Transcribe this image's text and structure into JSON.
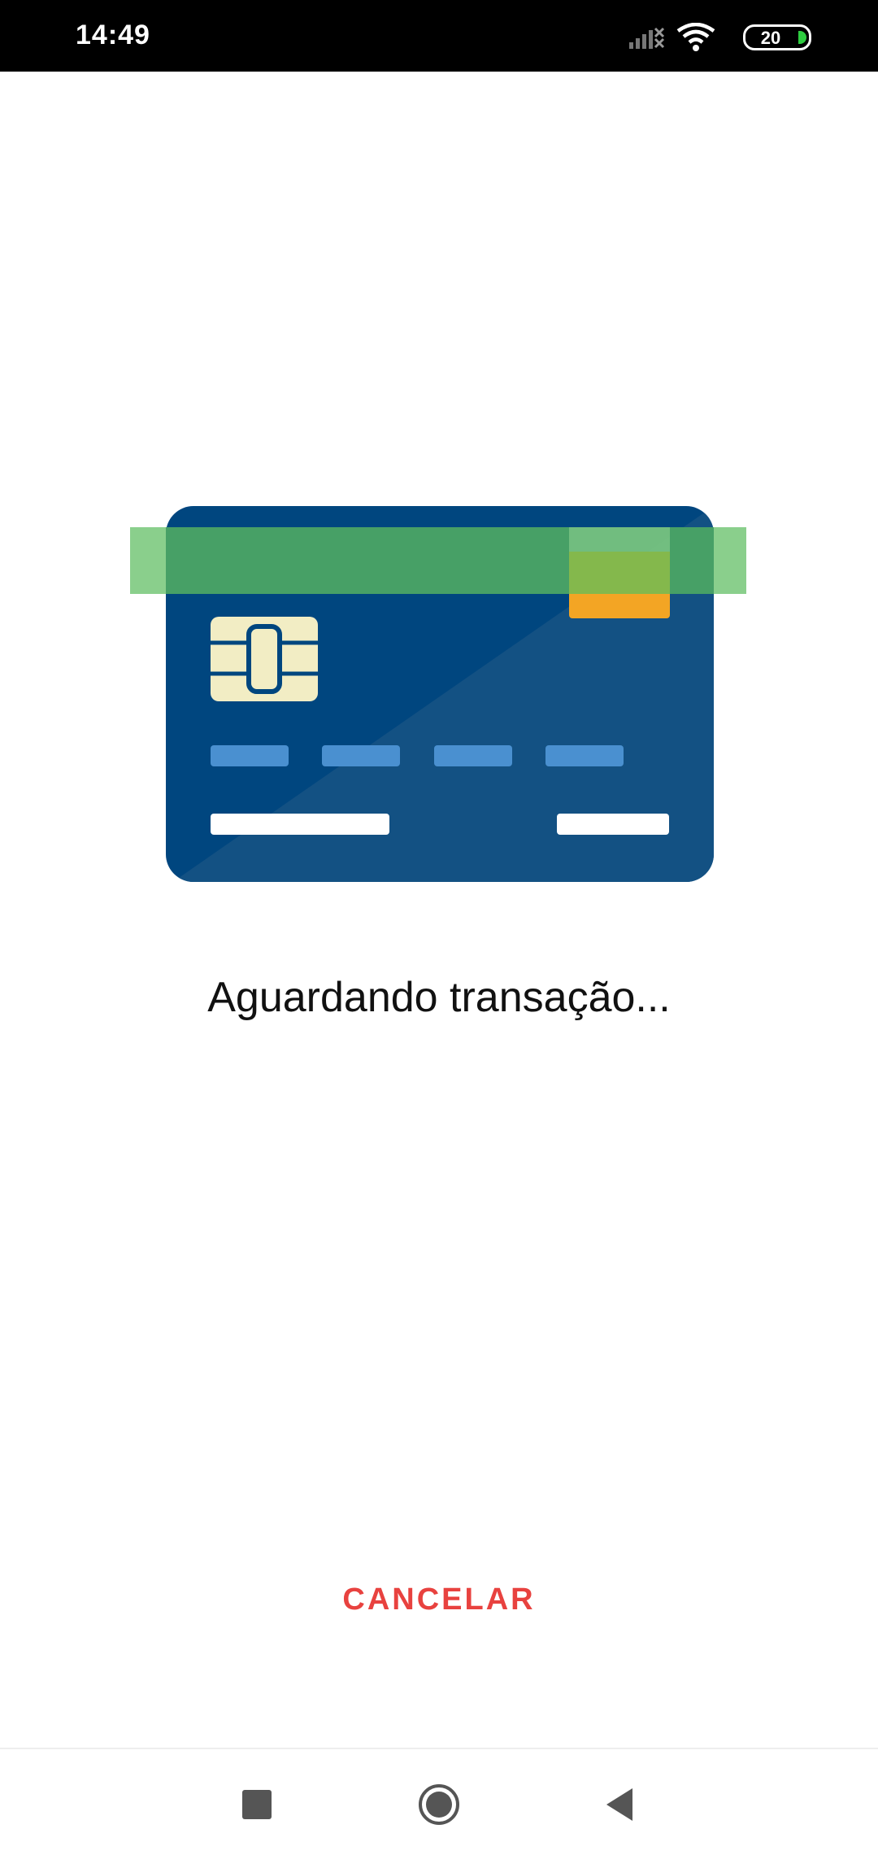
{
  "status_bar": {
    "time": "14:49",
    "battery_level": "20",
    "icons": [
      "signal-off-icon",
      "wifi-icon",
      "battery-icon"
    ]
  },
  "illustration": {
    "name": "credit-card-illustration",
    "colors": {
      "card": "#00467F",
      "card_shade": "#135183",
      "chip": "#F2EDC4",
      "stripe": "#7DCA80",
      "hologram": "#F3A524",
      "digits": "#4A90D0",
      "bars": "#FFFFFF"
    }
  },
  "main": {
    "message": "Aguardando transação...",
    "cancel_label": "CANCELAR"
  },
  "nav_bar": {
    "icons": [
      "recents-square-icon",
      "home-circle-icon",
      "back-triangle-icon"
    ]
  },
  "colors": {
    "accent": "#E8423F",
    "status_bar_bg": "#000000",
    "background": "#FFFFFF"
  }
}
